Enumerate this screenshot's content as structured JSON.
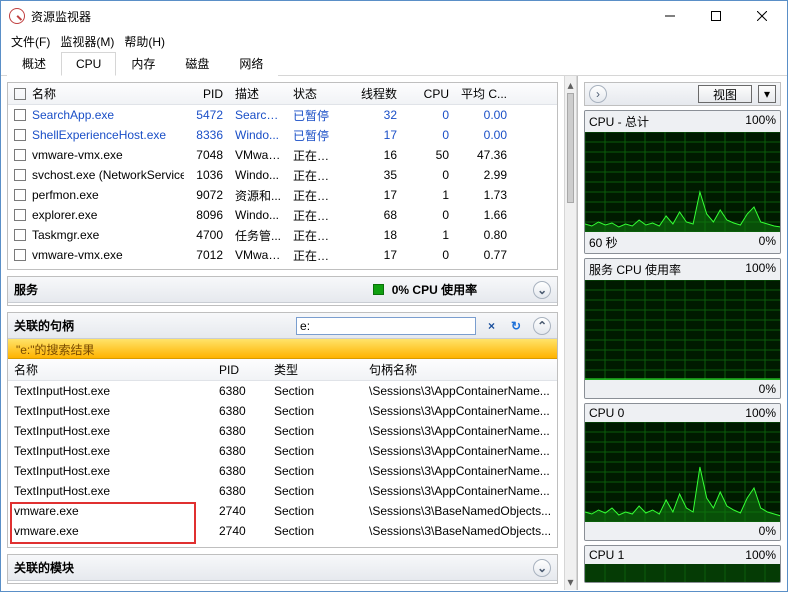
{
  "window": {
    "title": "资源监视器"
  },
  "menu": {
    "file": "文件(F)",
    "monitor": "监视器(M)",
    "help": "帮助(H)"
  },
  "tabs": {
    "overview": "概述",
    "cpu": "CPU",
    "memory": "内存",
    "disk": "磁盘",
    "network": "网络"
  },
  "processes": {
    "headers": {
      "name": "名称",
      "pid": "PID",
      "desc": "描述",
      "status": "状态",
      "threads": "线程数",
      "cpu": "CPU",
      "avg": "平均 C..."
    },
    "rows": [
      {
        "name": "SearchApp.exe",
        "pid": "5472",
        "desc": "Search...",
        "status": "已暂停",
        "threads": "32",
        "cpu": "0",
        "avg": "0.00",
        "blue": true
      },
      {
        "name": "ShellExperienceHost.exe",
        "pid": "8336",
        "desc": "Windo...",
        "status": "已暂停",
        "threads": "17",
        "cpu": "0",
        "avg": "0.00",
        "blue": true
      },
      {
        "name": "vmware-vmx.exe",
        "pid": "7048",
        "desc": "VMwar...",
        "status": "正在运行",
        "threads": "16",
        "cpu": "50",
        "avg": "47.36"
      },
      {
        "name": "svchost.exe (NetworkService)",
        "pid": "1036",
        "desc": "Windo...",
        "status": "正在运行",
        "threads": "35",
        "cpu": "0",
        "avg": "2.99"
      },
      {
        "name": "perfmon.exe",
        "pid": "9072",
        "desc": "资源和...",
        "status": "正在运行",
        "threads": "17",
        "cpu": "1",
        "avg": "1.73"
      },
      {
        "name": "explorer.exe",
        "pid": "8096",
        "desc": "Windo...",
        "status": "正在运行",
        "threads": "68",
        "cpu": "0",
        "avg": "1.66"
      },
      {
        "name": "Taskmgr.exe",
        "pid": "4700",
        "desc": "任务管...",
        "status": "正在运行",
        "threads": "18",
        "cpu": "1",
        "avg": "0.80"
      },
      {
        "name": "vmware-vmx.exe",
        "pid": "7012",
        "desc": "VMwar...",
        "status": "正在运行",
        "threads": "17",
        "cpu": "0",
        "avg": "0.77"
      }
    ]
  },
  "services": {
    "title": "服务",
    "usage_label": "0% CPU 使用率"
  },
  "handles": {
    "title": "关联的句柄",
    "search_value": "e:",
    "results_label": "\"e:\"的搜索结果",
    "headers": {
      "name": "名称",
      "pid": "PID",
      "type": "类型",
      "hname": "句柄名称"
    },
    "rows": [
      {
        "name": "TextInputHost.exe",
        "pid": "6380",
        "type": "Section",
        "hname": "\\Sessions\\3\\AppContainerName..."
      },
      {
        "name": "TextInputHost.exe",
        "pid": "6380",
        "type": "Section",
        "hname": "\\Sessions\\3\\AppContainerName..."
      },
      {
        "name": "TextInputHost.exe",
        "pid": "6380",
        "type": "Section",
        "hname": "\\Sessions\\3\\AppContainerName..."
      },
      {
        "name": "TextInputHost.exe",
        "pid": "6380",
        "type": "Section",
        "hname": "\\Sessions\\3\\AppContainerName..."
      },
      {
        "name": "TextInputHost.exe",
        "pid": "6380",
        "type": "Section",
        "hname": "\\Sessions\\3\\AppContainerName..."
      },
      {
        "name": "TextInputHost.exe",
        "pid": "6380",
        "type": "Section",
        "hname": "\\Sessions\\3\\AppContainerName..."
      },
      {
        "name": "vmware.exe",
        "pid": "2740",
        "type": "Section",
        "hname": "\\Sessions\\3\\BaseNamedObjects..."
      },
      {
        "name": "vmware.exe",
        "pid": "2740",
        "type": "Section",
        "hname": "\\Sessions\\3\\BaseNamedObjects..."
      }
    ]
  },
  "modules": {
    "title": "关联的模块"
  },
  "right": {
    "view_label": "视图",
    "charts": [
      {
        "title": "CPU - 总计",
        "rvalue": "100%",
        "foot_l": "60 秒",
        "foot_r": "0%",
        "wave": "high"
      },
      {
        "title": "服务 CPU 使用率",
        "rvalue": "100%",
        "foot_r": "0%",
        "wave": "flat"
      },
      {
        "title": "CPU 0",
        "rvalue": "100%",
        "foot_r": "0%",
        "wave": "high"
      },
      {
        "title": "CPU 1",
        "rvalue": "100%",
        "wave": "cut"
      }
    ]
  },
  "chart_data": {
    "type": "line",
    "xlabel": "60 秒",
    "ylim": [
      0,
      100
    ],
    "series": [
      {
        "name": "CPU - 总计",
        "approx_values": [
          8,
          6,
          10,
          7,
          9,
          5,
          8,
          6,
          12,
          7,
          9,
          6,
          16,
          8,
          20,
          10,
          8,
          40,
          18,
          10,
          22,
          12,
          9,
          7,
          18,
          25,
          10,
          8,
          6,
          5
        ]
      },
      {
        "name": "服务 CPU 使用率",
        "approx_values": [
          1,
          0,
          1,
          0,
          1,
          0,
          0,
          1,
          0,
          1,
          0,
          0,
          1,
          0,
          0,
          1,
          0,
          1,
          0,
          0,
          1,
          0,
          0,
          1,
          0,
          0,
          1,
          0,
          0,
          1
        ]
      },
      {
        "name": "CPU 0",
        "approx_values": [
          10,
          8,
          12,
          9,
          14,
          7,
          10,
          8,
          16,
          9,
          12,
          8,
          22,
          10,
          28,
          14,
          10,
          55,
          24,
          14,
          30,
          16,
          12,
          9,
          24,
          34,
          14,
          10,
          8,
          6
        ]
      }
    ]
  }
}
